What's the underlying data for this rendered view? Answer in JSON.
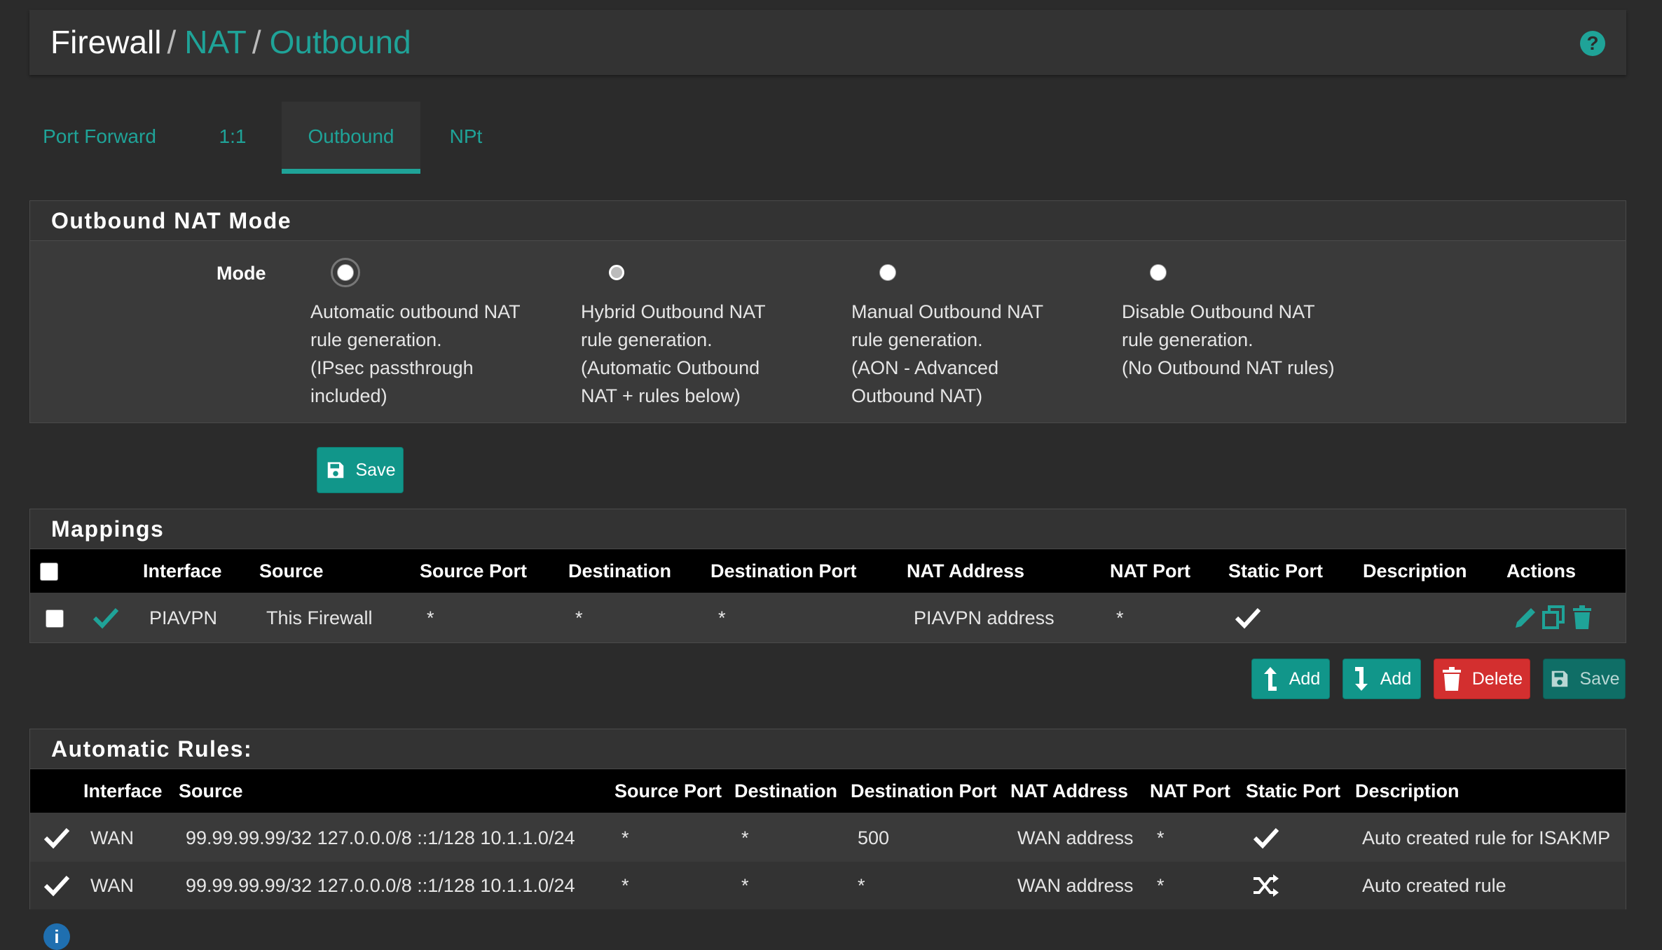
{
  "breadcrumb": {
    "root": "Firewall",
    "level2": "NAT",
    "level3": "Outbound",
    "separator": "/"
  },
  "help_icon": "question-circle-icon",
  "tabs": [
    {
      "label": "Port Forward",
      "active": false
    },
    {
      "label": "1:1",
      "active": false
    },
    {
      "label": "Outbound",
      "active": true
    },
    {
      "label": "NPt",
      "active": false
    }
  ],
  "mode_panel": {
    "title": "Outbound NAT Mode",
    "mode_label": "Mode",
    "options": [
      {
        "line1": "Automatic outbound NAT",
        "line2": "rule generation.",
        "line3": "(IPsec passthrough",
        "line4": "included)",
        "selected": true
      },
      {
        "line1": "Hybrid Outbound NAT",
        "line2": "rule generation.",
        "line3": "(Automatic Outbound",
        "line4": "NAT + rules below)",
        "selected": false
      },
      {
        "line1": "Manual Outbound NAT",
        "line2": "rule generation.",
        "line3": "(AON - Advanced",
        "line4": "Outbound NAT)",
        "selected": false
      },
      {
        "line1": "Disable Outbound NAT",
        "line2": "rule generation.",
        "line3": "(No Outbound NAT rules)",
        "line4": "",
        "selected": false
      }
    ],
    "save_label": "Save"
  },
  "mappings": {
    "title": "Mappings",
    "columns": [
      "Interface",
      "Source",
      "Source Port",
      "Destination",
      "Destination Port",
      "NAT Address",
      "NAT Port",
      "Static Port",
      "Description",
      "Actions"
    ],
    "rows": [
      {
        "enabled": true,
        "interface": "PIAVPN",
        "source": "This Firewall",
        "source_port": "*",
        "destination": "*",
        "destination_port": "*",
        "nat_address": "PIAVPN address",
        "nat_port": "*",
        "static_port": true,
        "description": ""
      }
    ],
    "buttons": {
      "add_top": "Add",
      "add_bottom": "Add",
      "delete": "Delete",
      "save": "Save"
    }
  },
  "automatic_rules": {
    "title": "Automatic Rules:",
    "columns": [
      "Interface",
      "Source",
      "Source Port",
      "Destination",
      "Destination Port",
      "NAT Address",
      "NAT Port",
      "Static Port",
      "Description"
    ],
    "rows": [
      {
        "interface": "WAN",
        "source": "99.99.99.99/32 127.0.0.0/8 ::1/128 10.1.1.0/24",
        "source_port": "*",
        "destination": "*",
        "destination_port": "500",
        "nat_address": "WAN address",
        "nat_port": "*",
        "static_port_icon": "check-icon",
        "description": "Auto created rule for ISAKMP"
      },
      {
        "interface": "WAN",
        "source": "99.99.99.99/32 127.0.0.0/8 ::1/128 10.1.1.0/24",
        "source_port": "*",
        "destination": "*",
        "destination_port": "*",
        "nat_address": "WAN address",
        "nat_port": "*",
        "static_port_icon": "shuffle-icon",
        "description": "Auto created rule"
      }
    ]
  },
  "colors": {
    "accent": "#1fa398",
    "background": "#2b2b2b",
    "panel": "#3a3a3a",
    "danger": "#d32f2f"
  }
}
